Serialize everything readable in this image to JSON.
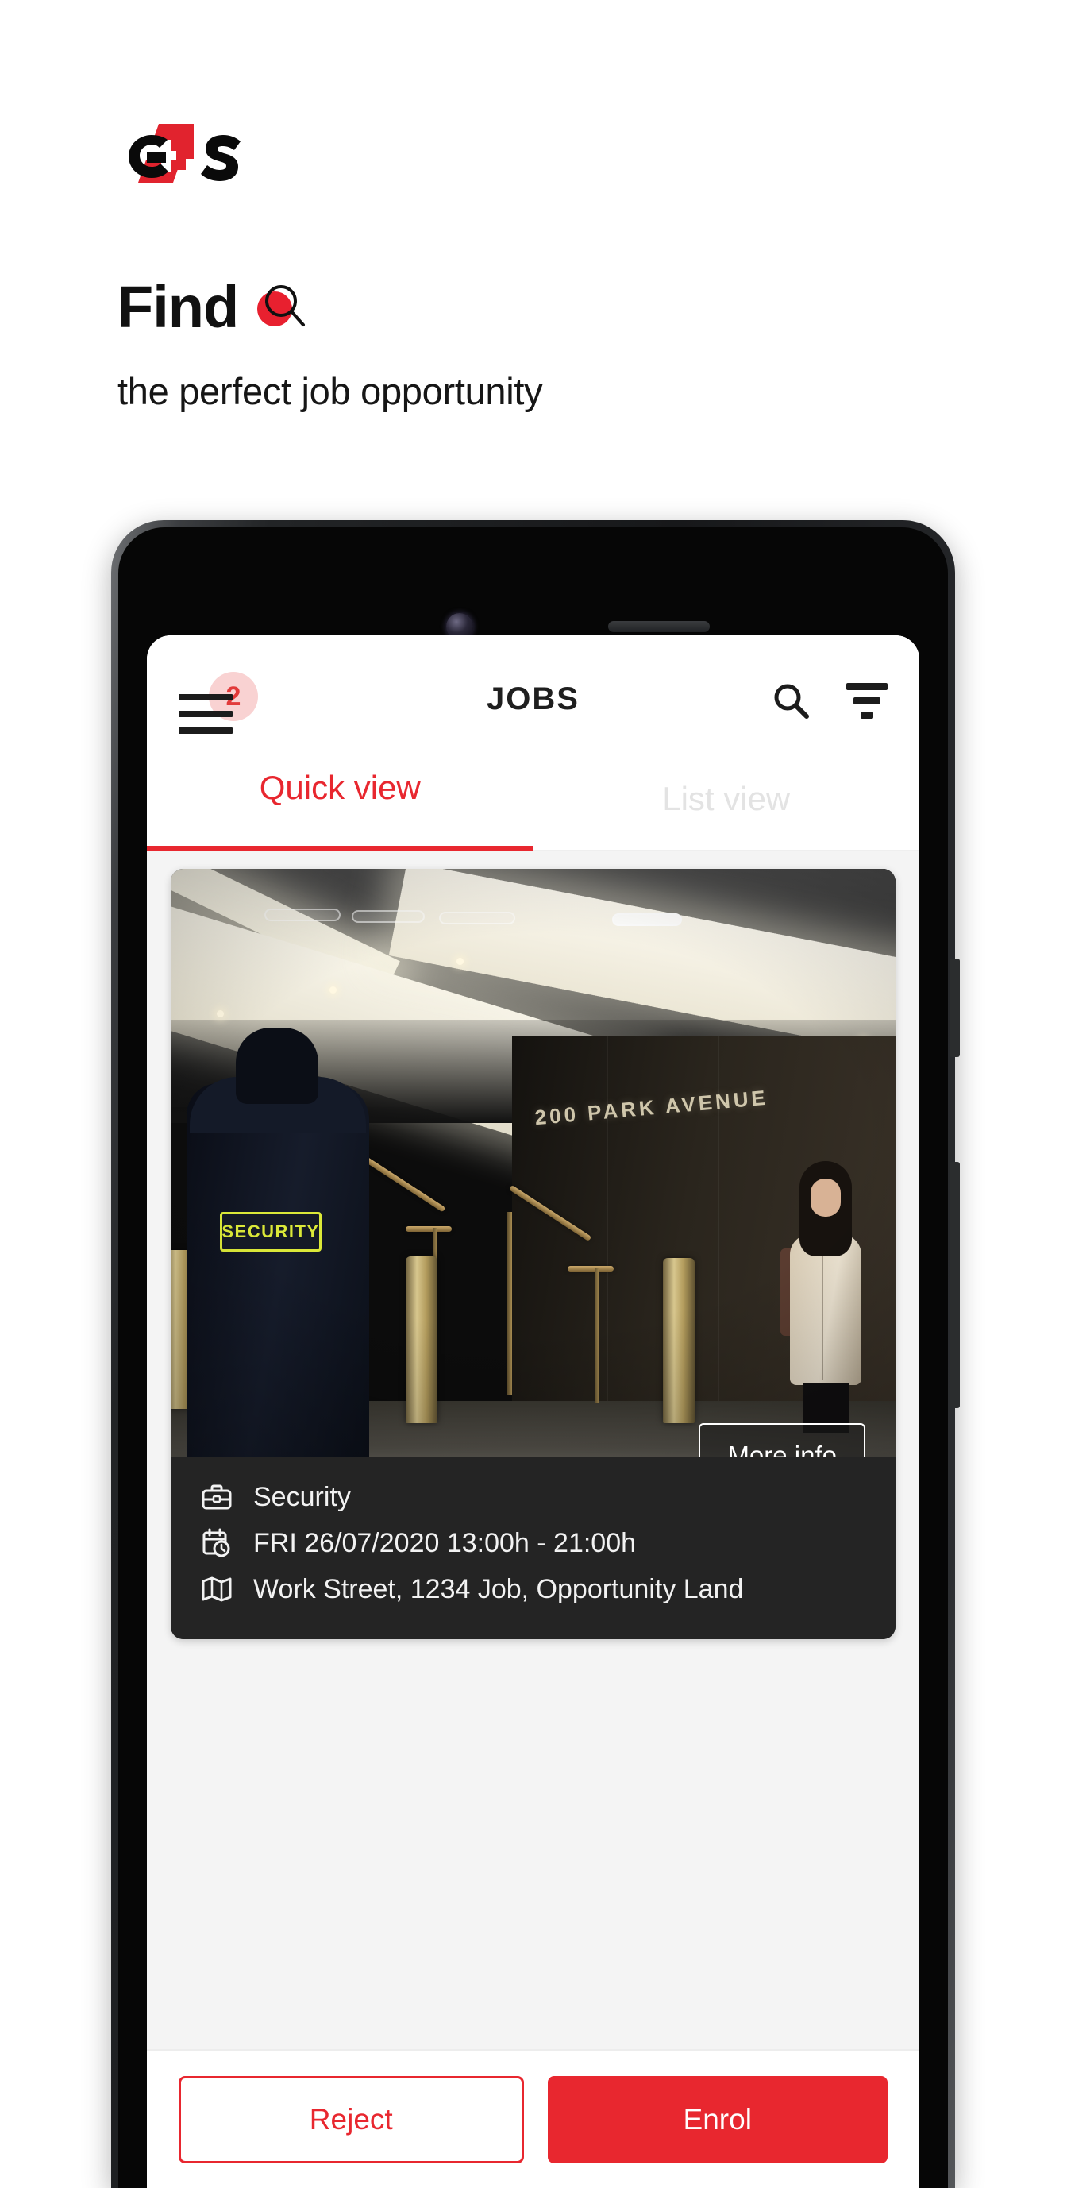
{
  "promo": {
    "logo_alt": "G4S",
    "headline": "Find",
    "headline_icon": "magnifier-icon",
    "subheadline": "the perfect job opportunity",
    "accent_color": "#e8272f",
    "text_color": "#111111"
  },
  "phone": {
    "camera": "front-camera",
    "speaker": "earpiece-speaker",
    "buttons": [
      "power-button",
      "volume-button"
    ]
  },
  "app": {
    "appbar": {
      "menu_icon": "hamburger-menu-icon",
      "notification_count": "2",
      "badge_bg": "#f9d2d2",
      "badge_color": "#e23a3a",
      "title": "JOBS",
      "search_icon": "search-icon",
      "filter_icon": "filter-icon"
    },
    "tabs": [
      {
        "label": "Quick view",
        "active": true
      },
      {
        "label": "List view",
        "active": false
      }
    ],
    "job_card": {
      "photo_alt": "security-guard-building-lobby",
      "photo_sign_text": "200 PARK AVENUE",
      "photo_patch_text": "SECURITY",
      "more_info_label": "More info",
      "details": [
        {
          "icon": "briefcase-icon",
          "text": "Security"
        },
        {
          "icon": "calendar-clock-icon",
          "text": "FRI 26/07/2020 13:00h - 21:00h"
        },
        {
          "icon": "map-icon",
          "text": "Work Street, 1234 Job, Opportunity Land"
        }
      ]
    },
    "actions": {
      "reject_label": "Reject",
      "enrol_label": "Enrol"
    }
  }
}
